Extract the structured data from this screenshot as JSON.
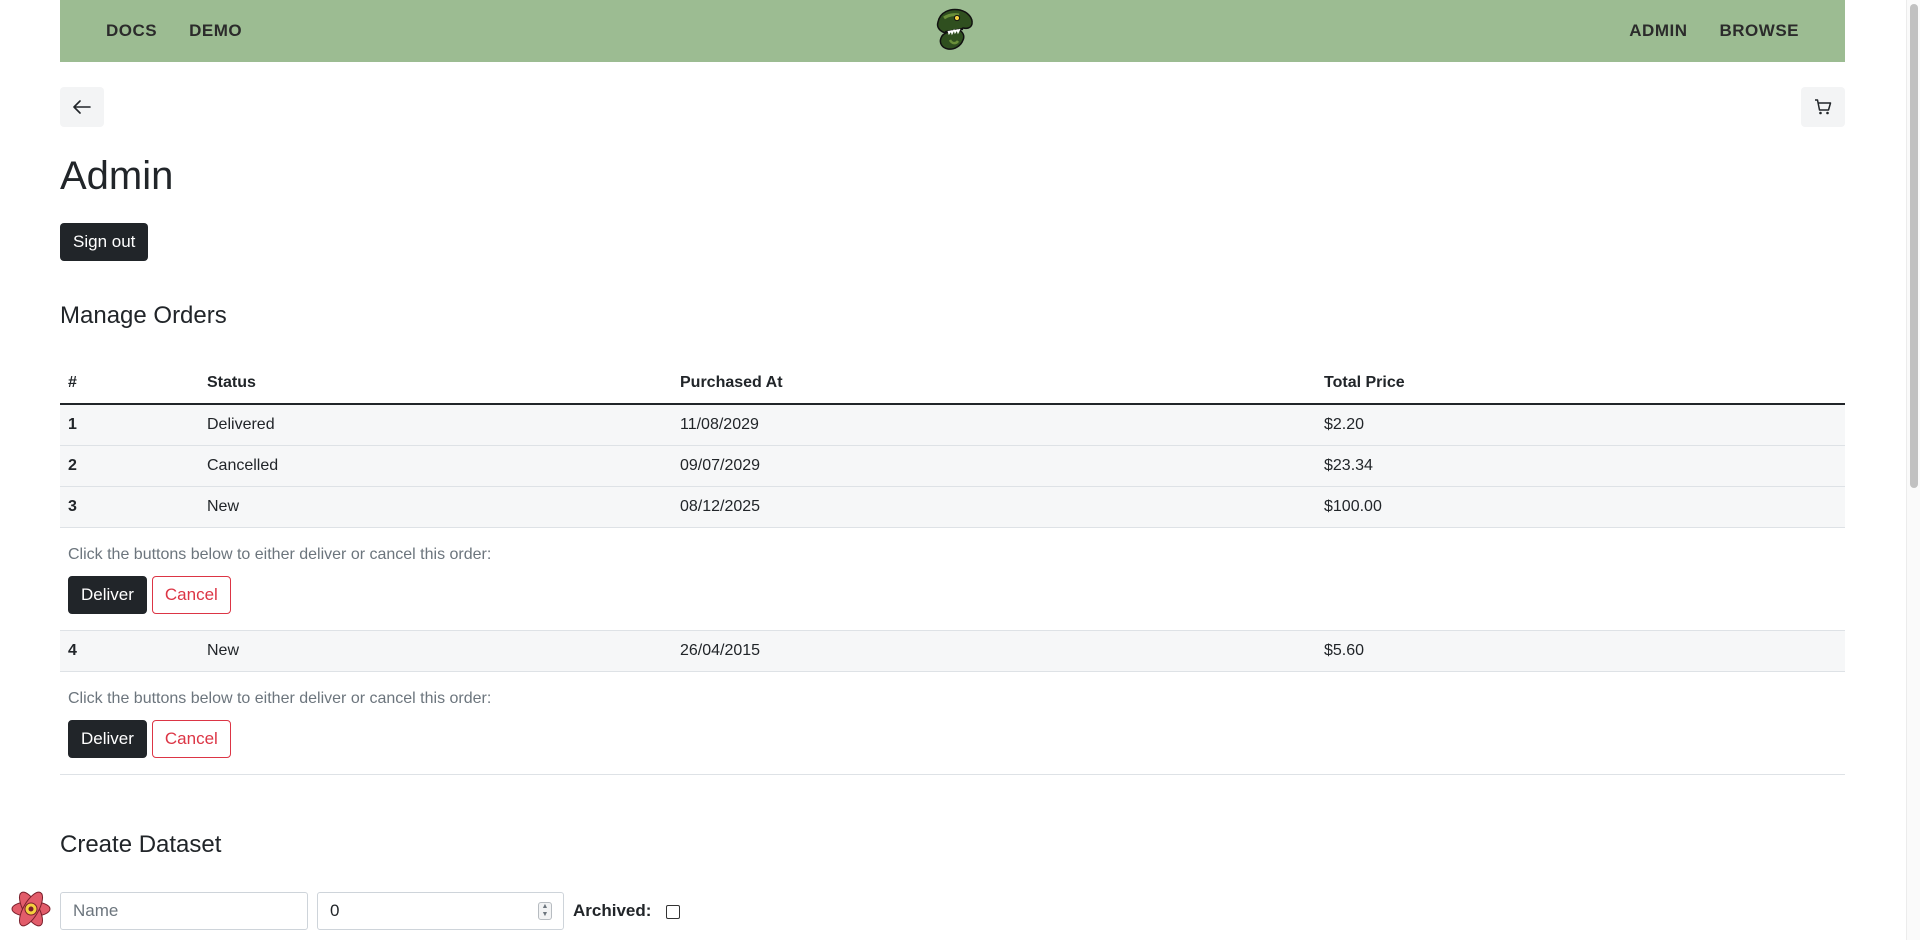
{
  "nav": {
    "left_links": [
      "DOCS",
      "DEMO"
    ],
    "right_links": [
      "ADMIN",
      "BROWSE"
    ],
    "bg_color": "#9cbc92",
    "logo_icon": "dinosaur-logo-icon"
  },
  "toolbar": {
    "back_icon": "arrow-left-icon",
    "cart_icon": "cart-icon"
  },
  "page": {
    "title": "Admin",
    "sign_out_label": "Sign out"
  },
  "orders": {
    "heading": "Manage Orders",
    "columns": [
      "#",
      "Status",
      "Purchased At",
      "Total Price"
    ],
    "rows": [
      {
        "id": "1",
        "status": "Delivered",
        "purchased_at": "11/08/2029",
        "total": "$2.20"
      },
      {
        "id": "2",
        "status": "Cancelled",
        "purchased_at": "09/07/2029",
        "total": "$23.34"
      },
      {
        "id": "3",
        "status": "New",
        "purchased_at": "08/12/2025",
        "total": "$100.00"
      },
      {
        "id": "4",
        "status": "New",
        "purchased_at": "26/04/2015",
        "total": "$5.60"
      }
    ],
    "action_note": "Click the buttons below to either deliver or cancel this order:",
    "deliver_label": "Deliver",
    "cancel_label": "Cancel"
  },
  "dataset": {
    "heading": "Create Dataset",
    "name_placeholder": "Name",
    "number_value": "0",
    "archived_label": "Archived:",
    "archived_checked": false
  },
  "colors": {
    "dark": "#212529",
    "danger": "#dc3545",
    "muted": "#6c757d"
  }
}
